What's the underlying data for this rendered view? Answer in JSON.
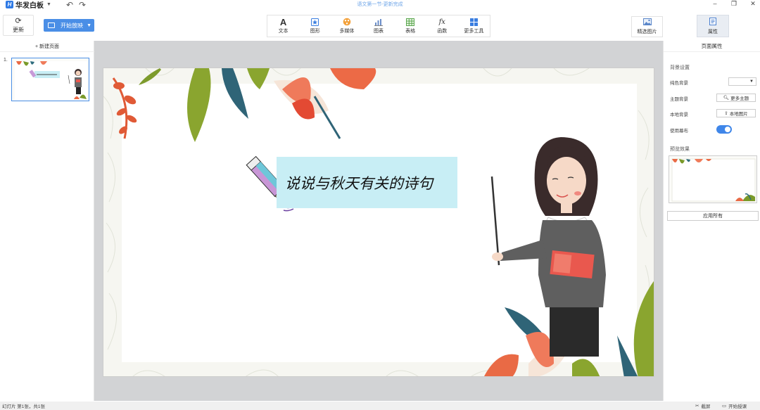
{
  "app": {
    "name": "华发白板",
    "doc_title": "语文第一节-更新完成"
  },
  "toolbar": {
    "refresh_label": "更新",
    "start_show_label": "开始放映",
    "tools": [
      {
        "icon": "text-icon",
        "label": "文本"
      },
      {
        "icon": "shape-icon",
        "label": "图形"
      },
      {
        "icon": "media-icon",
        "label": "多媒体"
      },
      {
        "icon": "chart-icon",
        "label": "图表"
      },
      {
        "icon": "table-icon",
        "label": "表格"
      },
      {
        "icon": "function-icon",
        "label": "函数"
      },
      {
        "icon": "more-tools-icon",
        "label": "更多工具"
      }
    ],
    "filter_image_label": "精选图片",
    "properties_label": "属性"
  },
  "left_panel": {
    "new_page_label": "+ 新建页面",
    "thumb_number": "1."
  },
  "slide": {
    "title": "说说与秋天有关的诗句"
  },
  "right_panel": {
    "title": "页面属性",
    "bg_settings": "背景设置",
    "solid_bg_label": "纯色背景",
    "theme_bg_label": "主题背景",
    "more_themes": "更多主题",
    "local_bg_label": "本地背景",
    "local_image": "本地图片",
    "use_curtain_label": "使用幕布",
    "preview_label": "预览效果",
    "apply_all": "应用所有"
  },
  "status": {
    "slide_info": "幻灯片 第1张，共1张",
    "screenshot": "截屏",
    "start_show": "开始授课"
  },
  "colors": {
    "accent": "#4a8ee6",
    "title_bg": "#c8eef5"
  }
}
